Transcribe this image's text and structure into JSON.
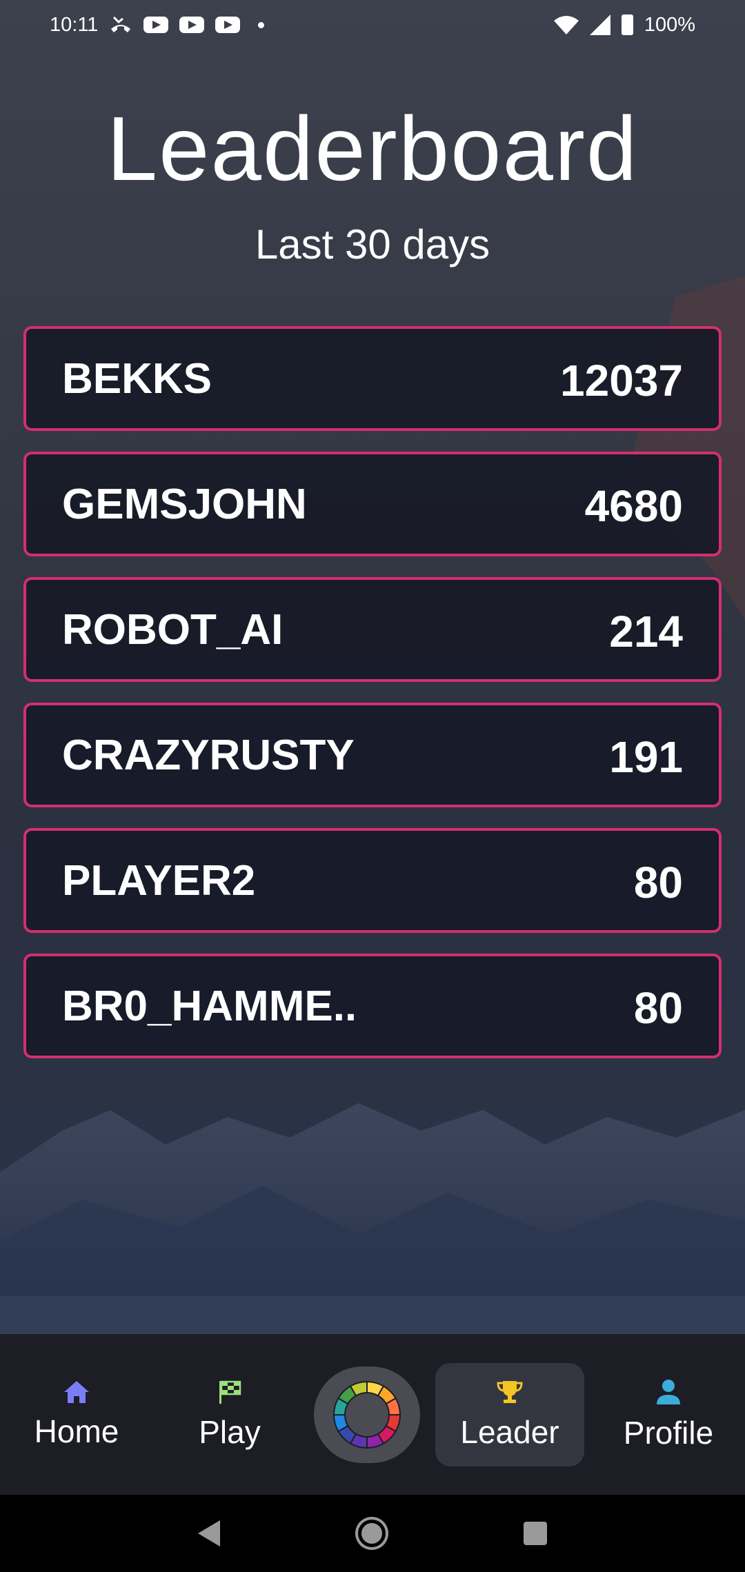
{
  "status_bar": {
    "time": "10:11",
    "battery": "100%",
    "icons_left": [
      "missed-call-icon",
      "youtube-icon",
      "youtube-icon",
      "youtube-icon",
      "dot-icon"
    ],
    "icons_right": [
      "wifi-icon",
      "cell-signal-icon",
      "battery-charging-icon"
    ]
  },
  "header": {
    "title": "Leaderboard",
    "subtitle": "Last 30 days"
  },
  "leaderboard": [
    {
      "name": "BEKKS",
      "score": "12037"
    },
    {
      "name": "GEMSJOHN",
      "score": "4680"
    },
    {
      "name": "ROBOT_AI",
      "score": "214"
    },
    {
      "name": "CRAZYRUSTY",
      "score": "191"
    },
    {
      "name": "PLAYER2",
      "score": "80"
    },
    {
      "name": "BR0_HAMME..",
      "score": "80"
    }
  ],
  "bottom_nav": {
    "items": [
      {
        "label": "Home",
        "icon": "home-icon",
        "color": "#7b7df5"
      },
      {
        "label": "Play",
        "icon": "checkered-flag-icon",
        "color": "#9ce07a"
      },
      {
        "label": "",
        "icon": "color-wheel-icon"
      },
      {
        "label": "Leader",
        "icon": "trophy-icon",
        "color": "#f3c623",
        "active": true
      },
      {
        "label": "Profile",
        "icon": "person-icon",
        "color": "#3aaed8"
      }
    ]
  },
  "colors": {
    "row_border": "#d22f6e",
    "row_background": "#161825",
    "nav_background": "#1c1d25",
    "active_tab": "#34363f"
  }
}
